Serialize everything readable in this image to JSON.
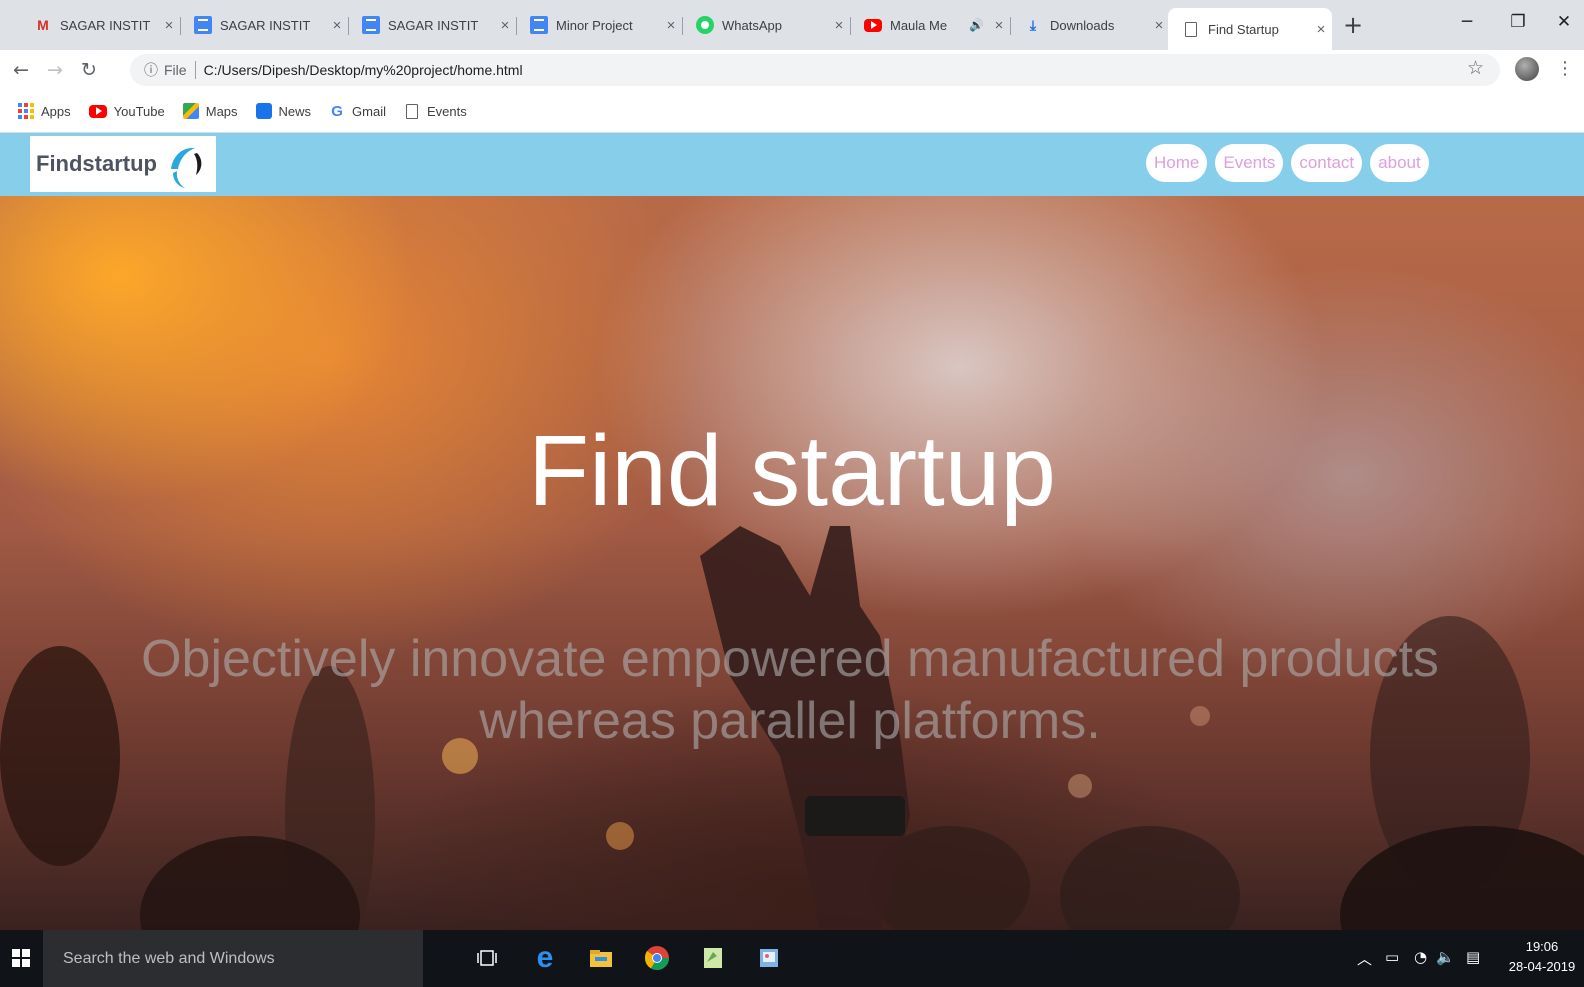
{
  "browser": {
    "tabs": [
      {
        "label": "SAGAR INSTIT",
        "icon": "gmail-icon",
        "active": false
      },
      {
        "label": "SAGAR INSTIT",
        "icon": "docs-icon",
        "active": false
      },
      {
        "label": "SAGAR INSTIT",
        "icon": "docs-icon",
        "active": false
      },
      {
        "label": "Minor Project",
        "icon": "docs-icon",
        "active": false
      },
      {
        "label": "WhatsApp",
        "icon": "whatsapp-icon",
        "active": false
      },
      {
        "label": "Maula Me",
        "icon": "youtube-icon",
        "active": false
      },
      {
        "label": "Downloads",
        "icon": "download-icon",
        "active": false
      },
      {
        "label": "Find Startup",
        "icon": "page-icon",
        "active": true
      }
    ],
    "close_glyph": "×",
    "new_tab_glyph": "+",
    "address": {
      "scheme_label": "File",
      "url": "C:/Users/Dipesh/Desktop/my%20project/home.html"
    },
    "bookmarks": [
      {
        "label": "Apps",
        "icon": "apps-grid-icon"
      },
      {
        "label": "YouTube",
        "icon": "youtube-icon"
      },
      {
        "label": "Maps",
        "icon": "maps-icon"
      },
      {
        "label": "News",
        "icon": "news-icon"
      },
      {
        "label": "Gmail",
        "icon": "google-icon"
      },
      {
        "label": "Events",
        "icon": "page-icon"
      }
    ]
  },
  "site": {
    "logo_text": "Findstartup",
    "nav": [
      "Home",
      "Events",
      "contact",
      "about"
    ],
    "hero_title": "Find startup",
    "hero_subtitle": "Objectively innovate empowered manufactured products whereas parallel platforms.",
    "colors": {
      "header_bg": "#87ceeb",
      "nav_text": "#dda0dd",
      "logo_blue": "#29a8e0"
    }
  },
  "taskbar": {
    "search_placeholder": "Search the web and Windows",
    "time": "19:06",
    "date": "28-04-2019"
  }
}
